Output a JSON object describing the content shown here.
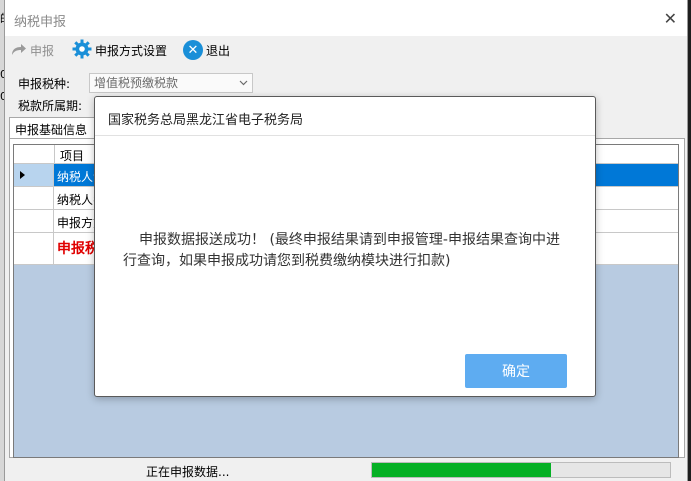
{
  "window": {
    "title": "纳税申报"
  },
  "toolbar": {
    "declare_label": "申报",
    "settings_label": "申报方式设置",
    "exit_label": "退出"
  },
  "form": {
    "tax_type_label": "申报税种:",
    "tax_type_value": "增值税预缴税款",
    "period_label": "税款所属期:"
  },
  "tab": {
    "label": "申报基础信息"
  },
  "grid": {
    "column_header": "项目",
    "rows": [
      "纳税人识",
      "纳税人名",
      "申报方式",
      "申报税"
    ]
  },
  "status": {
    "message": "正在申报数据...",
    "progress": 0.6
  },
  "dialog": {
    "title": "国家税务总局黑龙江省电子税务局",
    "message": "申报数据报送成功！  (最终申报结果请到申报管理-申报结果查询中进行查询，如果申报成功请您到税费缴纳模块进行扣款)",
    "ok_label": "确定"
  },
  "colors": {
    "accent": "#0078d7",
    "button": "#5eacf1",
    "progress": "#06b025",
    "grid_bg": "#b8cbe1",
    "warning_text": "#e00000"
  }
}
